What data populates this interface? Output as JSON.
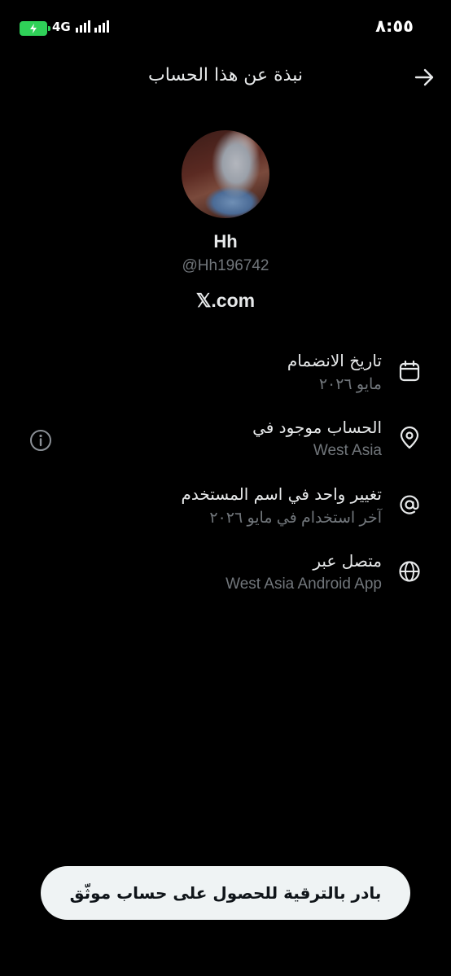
{
  "status_bar": {
    "time": "٨:٥٥",
    "network": "4G",
    "battery_color": "#2fd158"
  },
  "header": {
    "title": "نبذة عن هذا الحساب"
  },
  "profile": {
    "name": "Hh",
    "handle": "@Hh196742",
    "site": "𝕏.com"
  },
  "details": [
    {
      "icon": "calendar-icon",
      "title": "تاريخ الانضمام",
      "subtitle": "مايو ٢٠٢٦"
    },
    {
      "icon": "location-pin-icon",
      "title": "الحساب موجود في",
      "subtitle": "West Asia"
    },
    {
      "icon": "at-sign-icon",
      "title": "تغيير واحد في اسم المستخدم",
      "subtitle": "آخر استخدام في مايو ٢٠٢٦"
    },
    {
      "icon": "globe-icon",
      "title": "متصل عبر",
      "subtitle": "West Asia Android App"
    }
  ],
  "cta": {
    "label": "بادر بالترقية للحصول على حساب موثّق"
  },
  "colors": {
    "background": "#000000",
    "primary_text": "#e7e9ea",
    "secondary_text": "#71767b",
    "button_bg": "#eff3f4"
  }
}
